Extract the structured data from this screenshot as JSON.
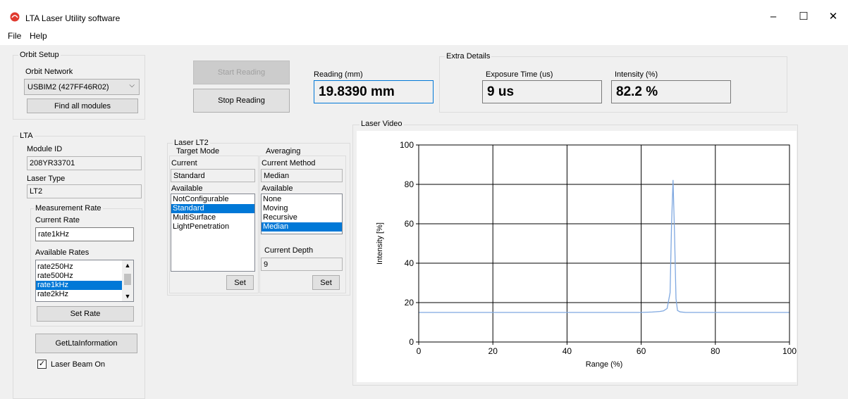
{
  "window": {
    "title": "LTA Laser Utility software",
    "minimize_glyph": "–",
    "maximize_glyph": "☐",
    "close_glyph": "✕"
  },
  "menu": {
    "file": "File",
    "help": "Help"
  },
  "orbit_setup": {
    "group_label": "Orbit Setup",
    "network_label": "Orbit Network",
    "network_value": "USBIM2 (427FF46R02)",
    "find_button": "Find all modules"
  },
  "lta": {
    "group_label": "LTA",
    "module_id_label": "Module ID",
    "module_id_value": "208YR33701",
    "laser_type_label": "Laser Type",
    "laser_type_value": "LT2",
    "measurement_rate": {
      "group_label": "Measurement Rate",
      "current_rate_label": "Current Rate",
      "current_rate_value": "rate1kHz",
      "available_rates_label": "Available Rates",
      "rates": [
        "rate250Hz",
        "rate500Hz",
        "rate1kHz",
        "rate2kHz"
      ],
      "selected_index": 2,
      "set_rate_button": "Set Rate"
    },
    "get_info_button": "GetLtaInformation",
    "laser_beam_label": "Laser Beam On",
    "laser_beam_checked": true
  },
  "reading": {
    "start_button": "Start Reading",
    "stop_button": "Stop Reading",
    "label": "Reading (mm)",
    "value": "19.8390 mm"
  },
  "extra_details": {
    "group_label": "Extra Details",
    "exposure_label": "Exposure Time (us)",
    "exposure_value": "9 us",
    "intensity_label": "Intensity (%)",
    "intensity_value": "82.2 %"
  },
  "laser_lt2": {
    "group_label": "Laser LT2",
    "target_mode": {
      "group_label": "Target Mode",
      "current_label": "Current",
      "current_value": "Standard",
      "available_label": "Available",
      "options": [
        "NotConfigurable",
        "Standard",
        "MultiSurface",
        "LightPenetration"
      ],
      "selected_index": 1,
      "set_button": "Set"
    },
    "averaging": {
      "group_label": "Averaging",
      "current_method_label": "Current Method",
      "current_method_value": "Median",
      "available_label": "Available",
      "options": [
        "None",
        "Moving",
        "Recursive",
        "Median"
      ],
      "selected_index": 3,
      "current_depth_label": "Current Depth",
      "current_depth_value": "9",
      "set_button": "Set"
    }
  },
  "laser_video": {
    "group_label": "Laser Video"
  },
  "colors": {
    "accent": "#0078d7",
    "series": "#7fa8e0",
    "client_bg": "#f0f0f0"
  },
  "chart_data": {
    "type": "line",
    "xlabel": "Range (%)",
    "ylabel": "Intensity [%]",
    "xlim": [
      0,
      100
    ],
    "ylim": [
      0,
      100
    ],
    "x_ticks": [
      0,
      20,
      40,
      60,
      80,
      100
    ],
    "y_ticks": [
      0,
      20,
      40,
      60,
      80,
      100
    ],
    "grid": true,
    "legend": "none",
    "series": [
      {
        "x": [
          0,
          10,
          20,
          30,
          40,
          50,
          60,
          63,
          65,
          66,
          67,
          67.8,
          68.2,
          68.6,
          69,
          69.4,
          69.8,
          70.5,
          72,
          80,
          90,
          100
        ],
        "y": [
          15,
          15,
          15,
          15,
          15,
          15,
          15,
          15.2,
          15.5,
          15.8,
          17,
          25,
          60,
          82.2,
          55,
          22,
          16,
          15.3,
          15,
          15,
          15,
          15
        ]
      }
    ]
  }
}
